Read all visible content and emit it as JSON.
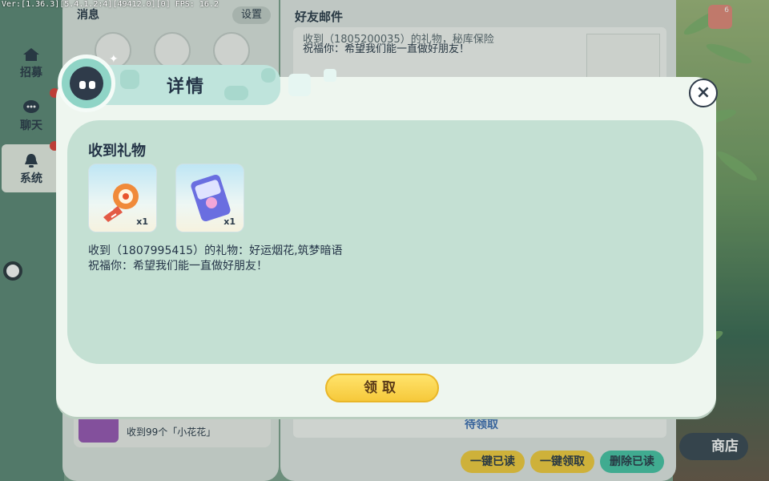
{
  "version_text": "Ver:[1.36.3][5.4.1.2:4][49412.0][0] FPS: 16.2",
  "left_nav": {
    "items": [
      {
        "label": "招募",
        "icon": "home-icon"
      },
      {
        "label": "聊天",
        "icon": "chat-icon"
      },
      {
        "label": "系统",
        "icon": "bell-icon"
      }
    ]
  },
  "messages_panel": {
    "title": "消息",
    "settings_label": "设置",
    "item_text": "收到99个「小花花」"
  },
  "mail_panel": {
    "title": "好友邮件",
    "preview_line1": "收到（1805200035）的礼物，秘库保险",
    "preview_line2": "祝福你：希望我们能一直做好朋友！",
    "pending_label": "待领取",
    "mark_read_label": "一键已读",
    "claim_all_label": "一键领取",
    "delete_read_label": "删除已读",
    "shop_label": "商店",
    "mail_badge": "6"
  },
  "dialog": {
    "title": "详情",
    "close_label": "×",
    "section_title": "收到礼物",
    "gifts": [
      {
        "name": "好运烟花",
        "qty": "x1"
      },
      {
        "name": "筑梦暗语",
        "qty": "x1"
      }
    ],
    "text_line1": "收到（1807995415）的礼物：好运烟花,筑梦暗语",
    "text_line2": "祝福你：希望我们能一直做好朋友！",
    "claim_label": "领取"
  },
  "colors": {
    "accent_yellow": "#f6cf3f",
    "accent_teal": "#48c7a8",
    "link_blue": "#3d6fb5"
  }
}
